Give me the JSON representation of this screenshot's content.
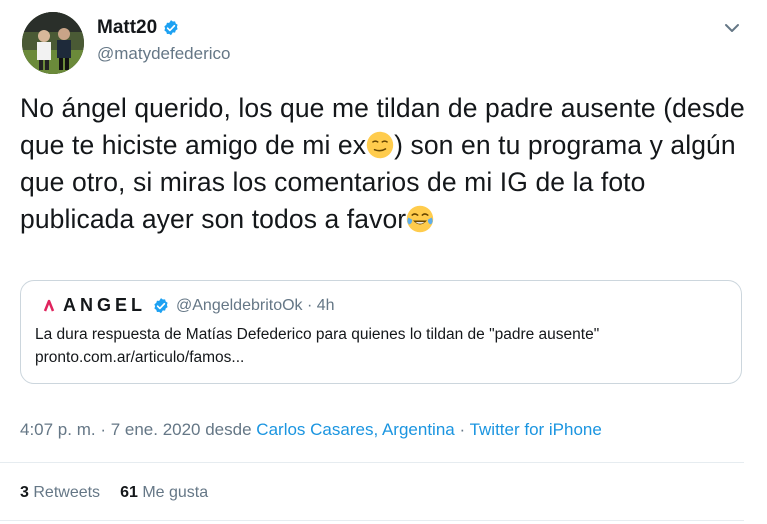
{
  "tweet": {
    "display_name": "Matt20",
    "handle": "@matydefederico",
    "text_part1": "No ángel querido, los que me tildan de padre ausente (desde que te hiciste amigo de mi ex",
    "text_part2": ") son en tu programa y algún que otro, si miras los comentarios de mi IG de la foto publicada ayer son todos a favor",
    "emoji_1": "smirk-face-icon",
    "emoji_2": "tears-of-joy-icon",
    "timestamp": "4:07 p. m. · 7 ene. 2020 desde",
    "location": "Carlos Casares, Argentina",
    "separator": "·",
    "source": "Twitter for iPhone",
    "retweets_count": "3",
    "retweets_label": "Retweets",
    "likes_count": "61",
    "likes_label": "Me gusta"
  },
  "quote": {
    "name": "ANGEL",
    "handle_time": "@AngeldebritoOk · 4h",
    "text": "La dura respuesta de Matías Defederico para quienes lo tildan de \"padre ausente\"",
    "link": "pronto.com.ar/articulo/famos..."
  },
  "colors": {
    "accent": "#1b95e0",
    "verified": "#1da1f2",
    "secondary_text": "#657786",
    "border": "#ccd6dd"
  }
}
